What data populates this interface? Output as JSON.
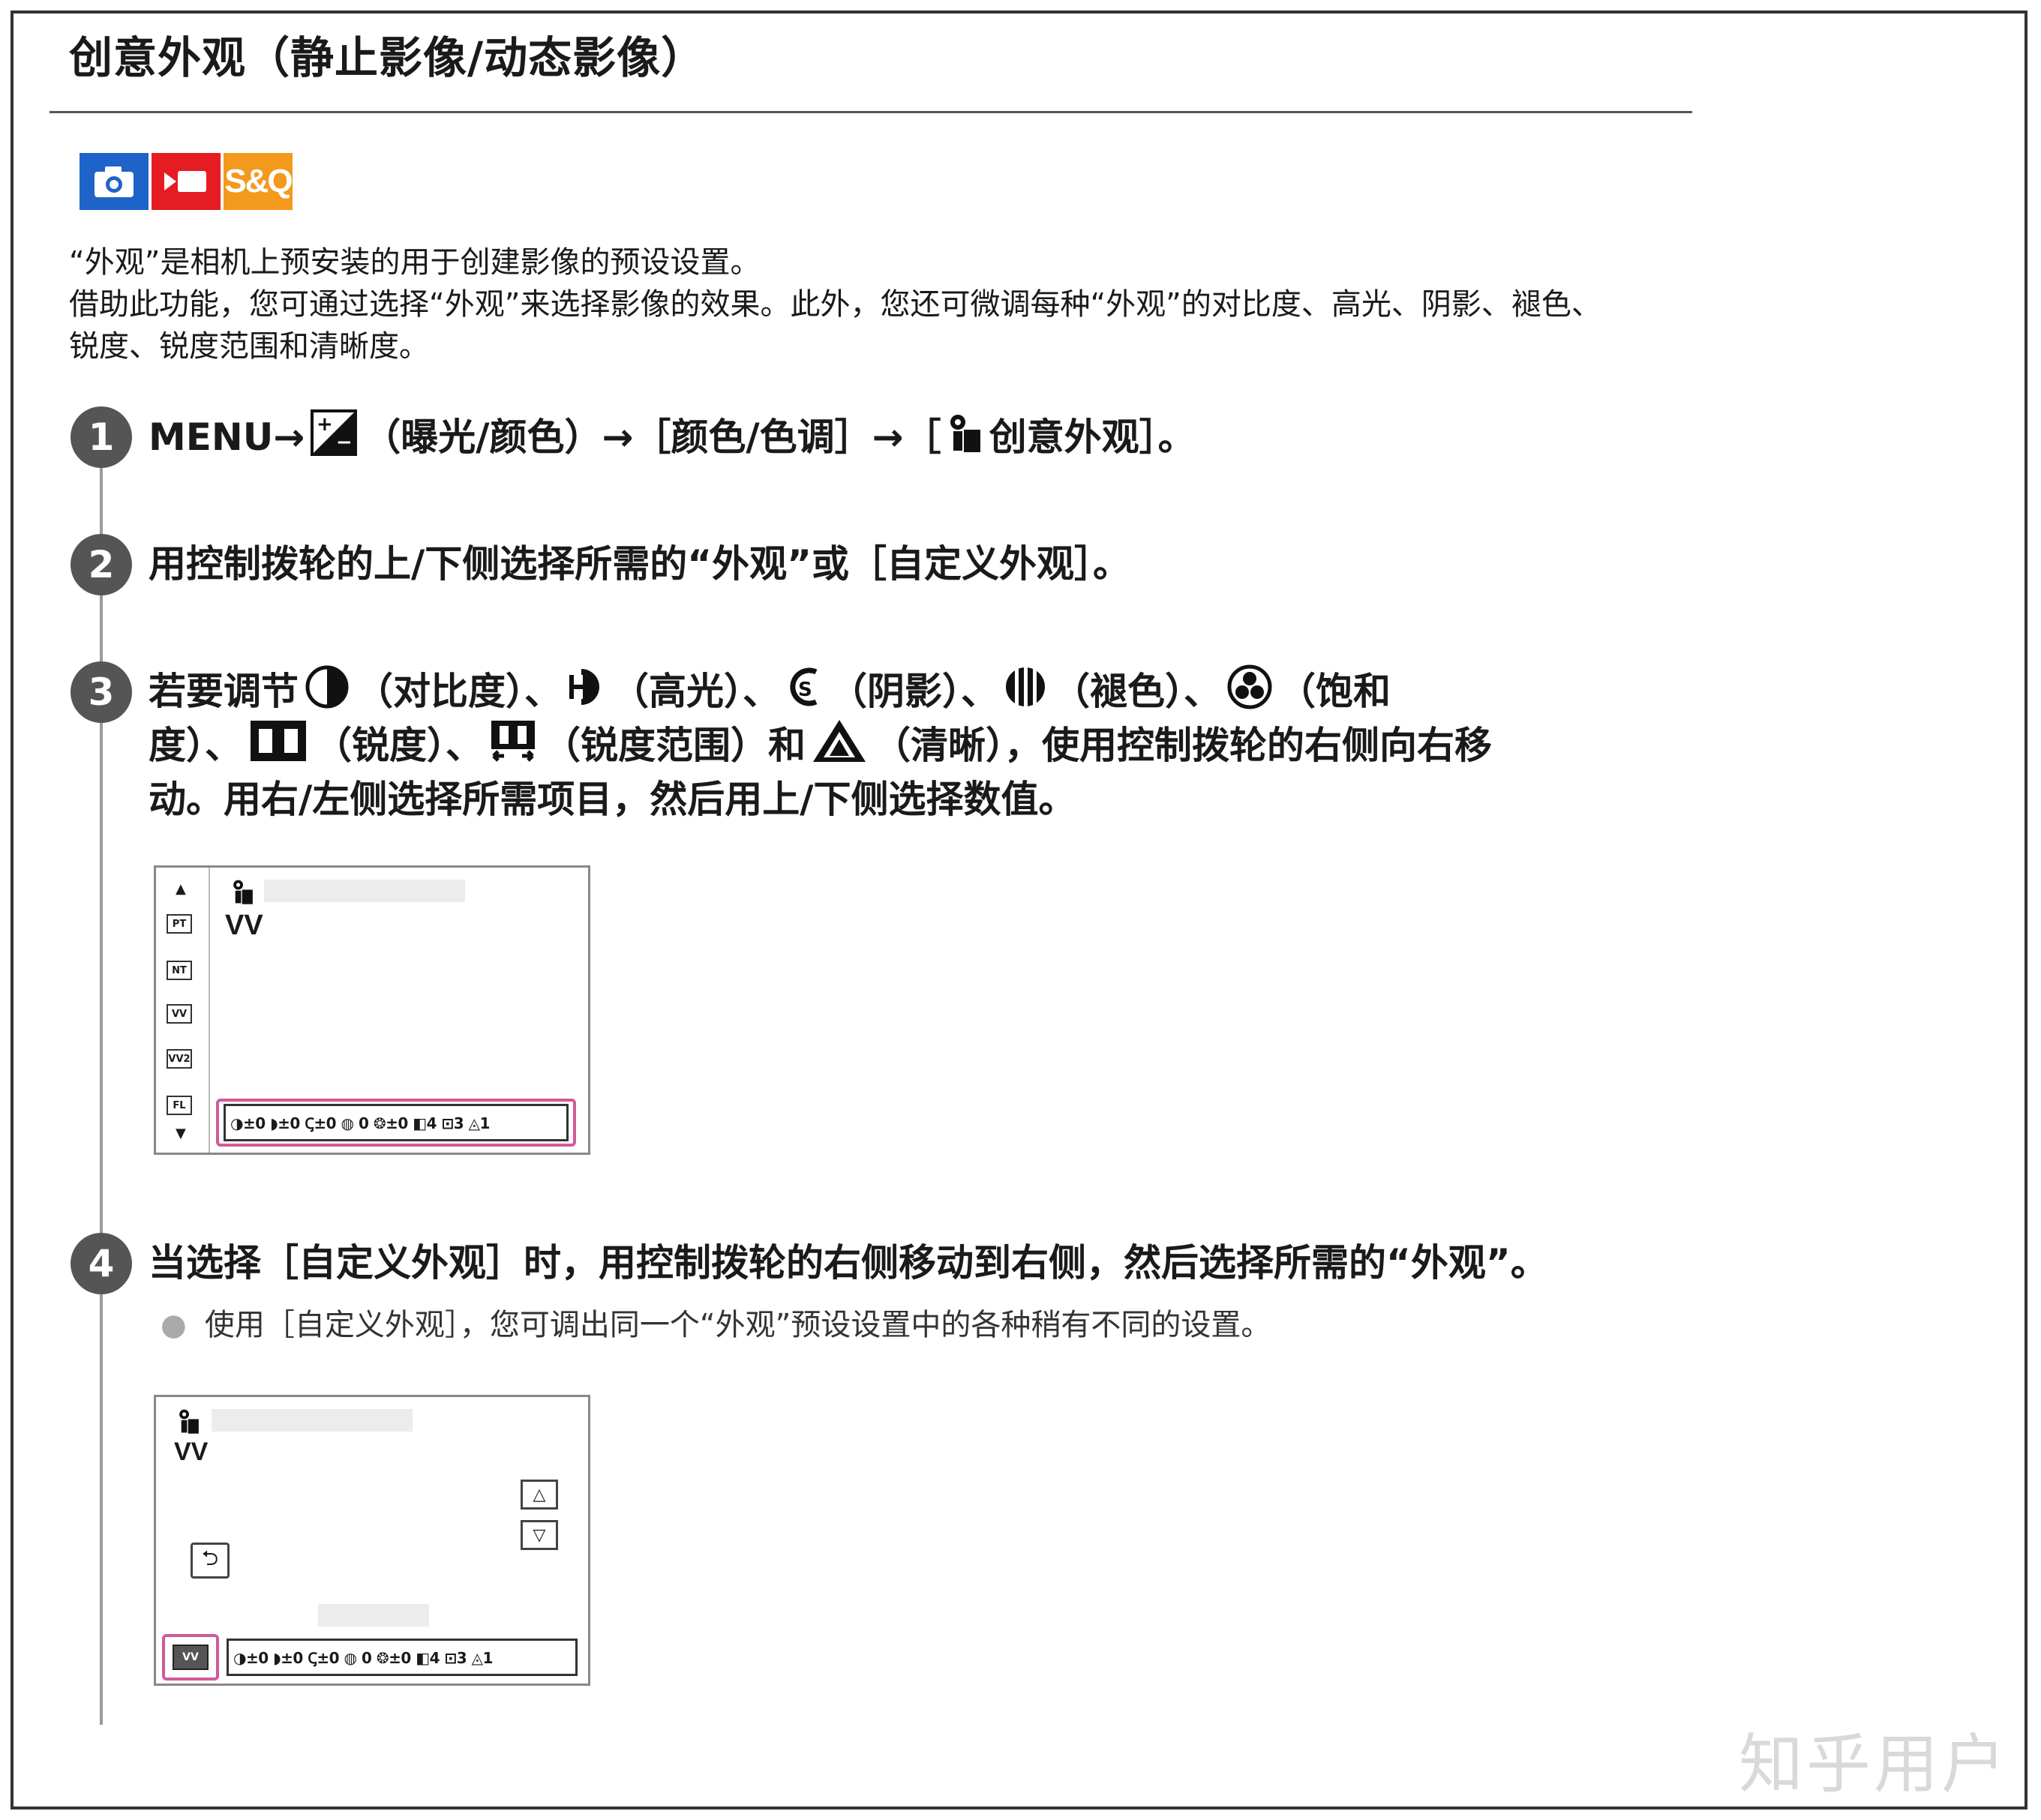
{
  "title": "创意外观（静止影像/动态影像）",
  "badges": {
    "sq_label": "S&Q"
  },
  "intro": {
    "line1": "“外观”是相机上预安装的用于创建影像的预设设置。",
    "line2": "借助此功能，您可通过选择“外观”来选择影像的效果。此外，您还可微调每种“外观”的对比度、高光、阴影、褪色、",
    "line3": "锐度、锐度范围和清晰度。"
  },
  "steps": [
    {
      "num": "1",
      "a": "MENU→",
      "b": "（曝光/颜色）→［颜色/色调］→［",
      "c": "创意外观］。"
    },
    {
      "num": "2",
      "a": "用控制拨轮的上/下侧选择所需的“外观”或［自定义外观］。"
    },
    {
      "num": "3",
      "l1a": "若要调节",
      "l1b": "（对比度）、",
      "l1c": "（高光）、",
      "l1d": "（阴影）、",
      "l1e": "（褪色）、",
      "l1f": "（饱和",
      "l2a": "度）、",
      "l2b": "（锐度）、",
      "l2c": "（锐度范围）和",
      "l2d": "（清晰），使用控制拨轮的右侧向右移",
      "l3": "动。用右/左侧选择所需项目，然后用上/下侧选择数值。"
    },
    {
      "num": "4",
      "a": "当选择［自定义外观］时，用控制拨轮的右侧移动到右侧，然后选择所需的“外观”。",
      "sub": "使用［自定义外观］，您可调出同一个“外观”预设设置中的各种稍有不同的设置。"
    }
  ],
  "screen1": {
    "list_icons": [
      "PT",
      "NT",
      "VV",
      "VV2",
      "FL"
    ],
    "look": "VV",
    "params": "◑±0 ◗±0 Ꞔ±0 ◍ 0 ❂±0 ◧4 ⊡3 ◬1"
  },
  "screen2": {
    "look": "VV",
    "custom_icon": "VV",
    "params": "◑±0 ◗±0 Ꞔ±0 ◍ 0 ❂±0 ◧4 ⊡3 ◬1"
  },
  "watermark": "知乎用户",
  "colors": {
    "still": "#1e63c7",
    "movie": "#e51c23",
    "sq": "#f39a1e",
    "highlight": "#d05a9a"
  }
}
